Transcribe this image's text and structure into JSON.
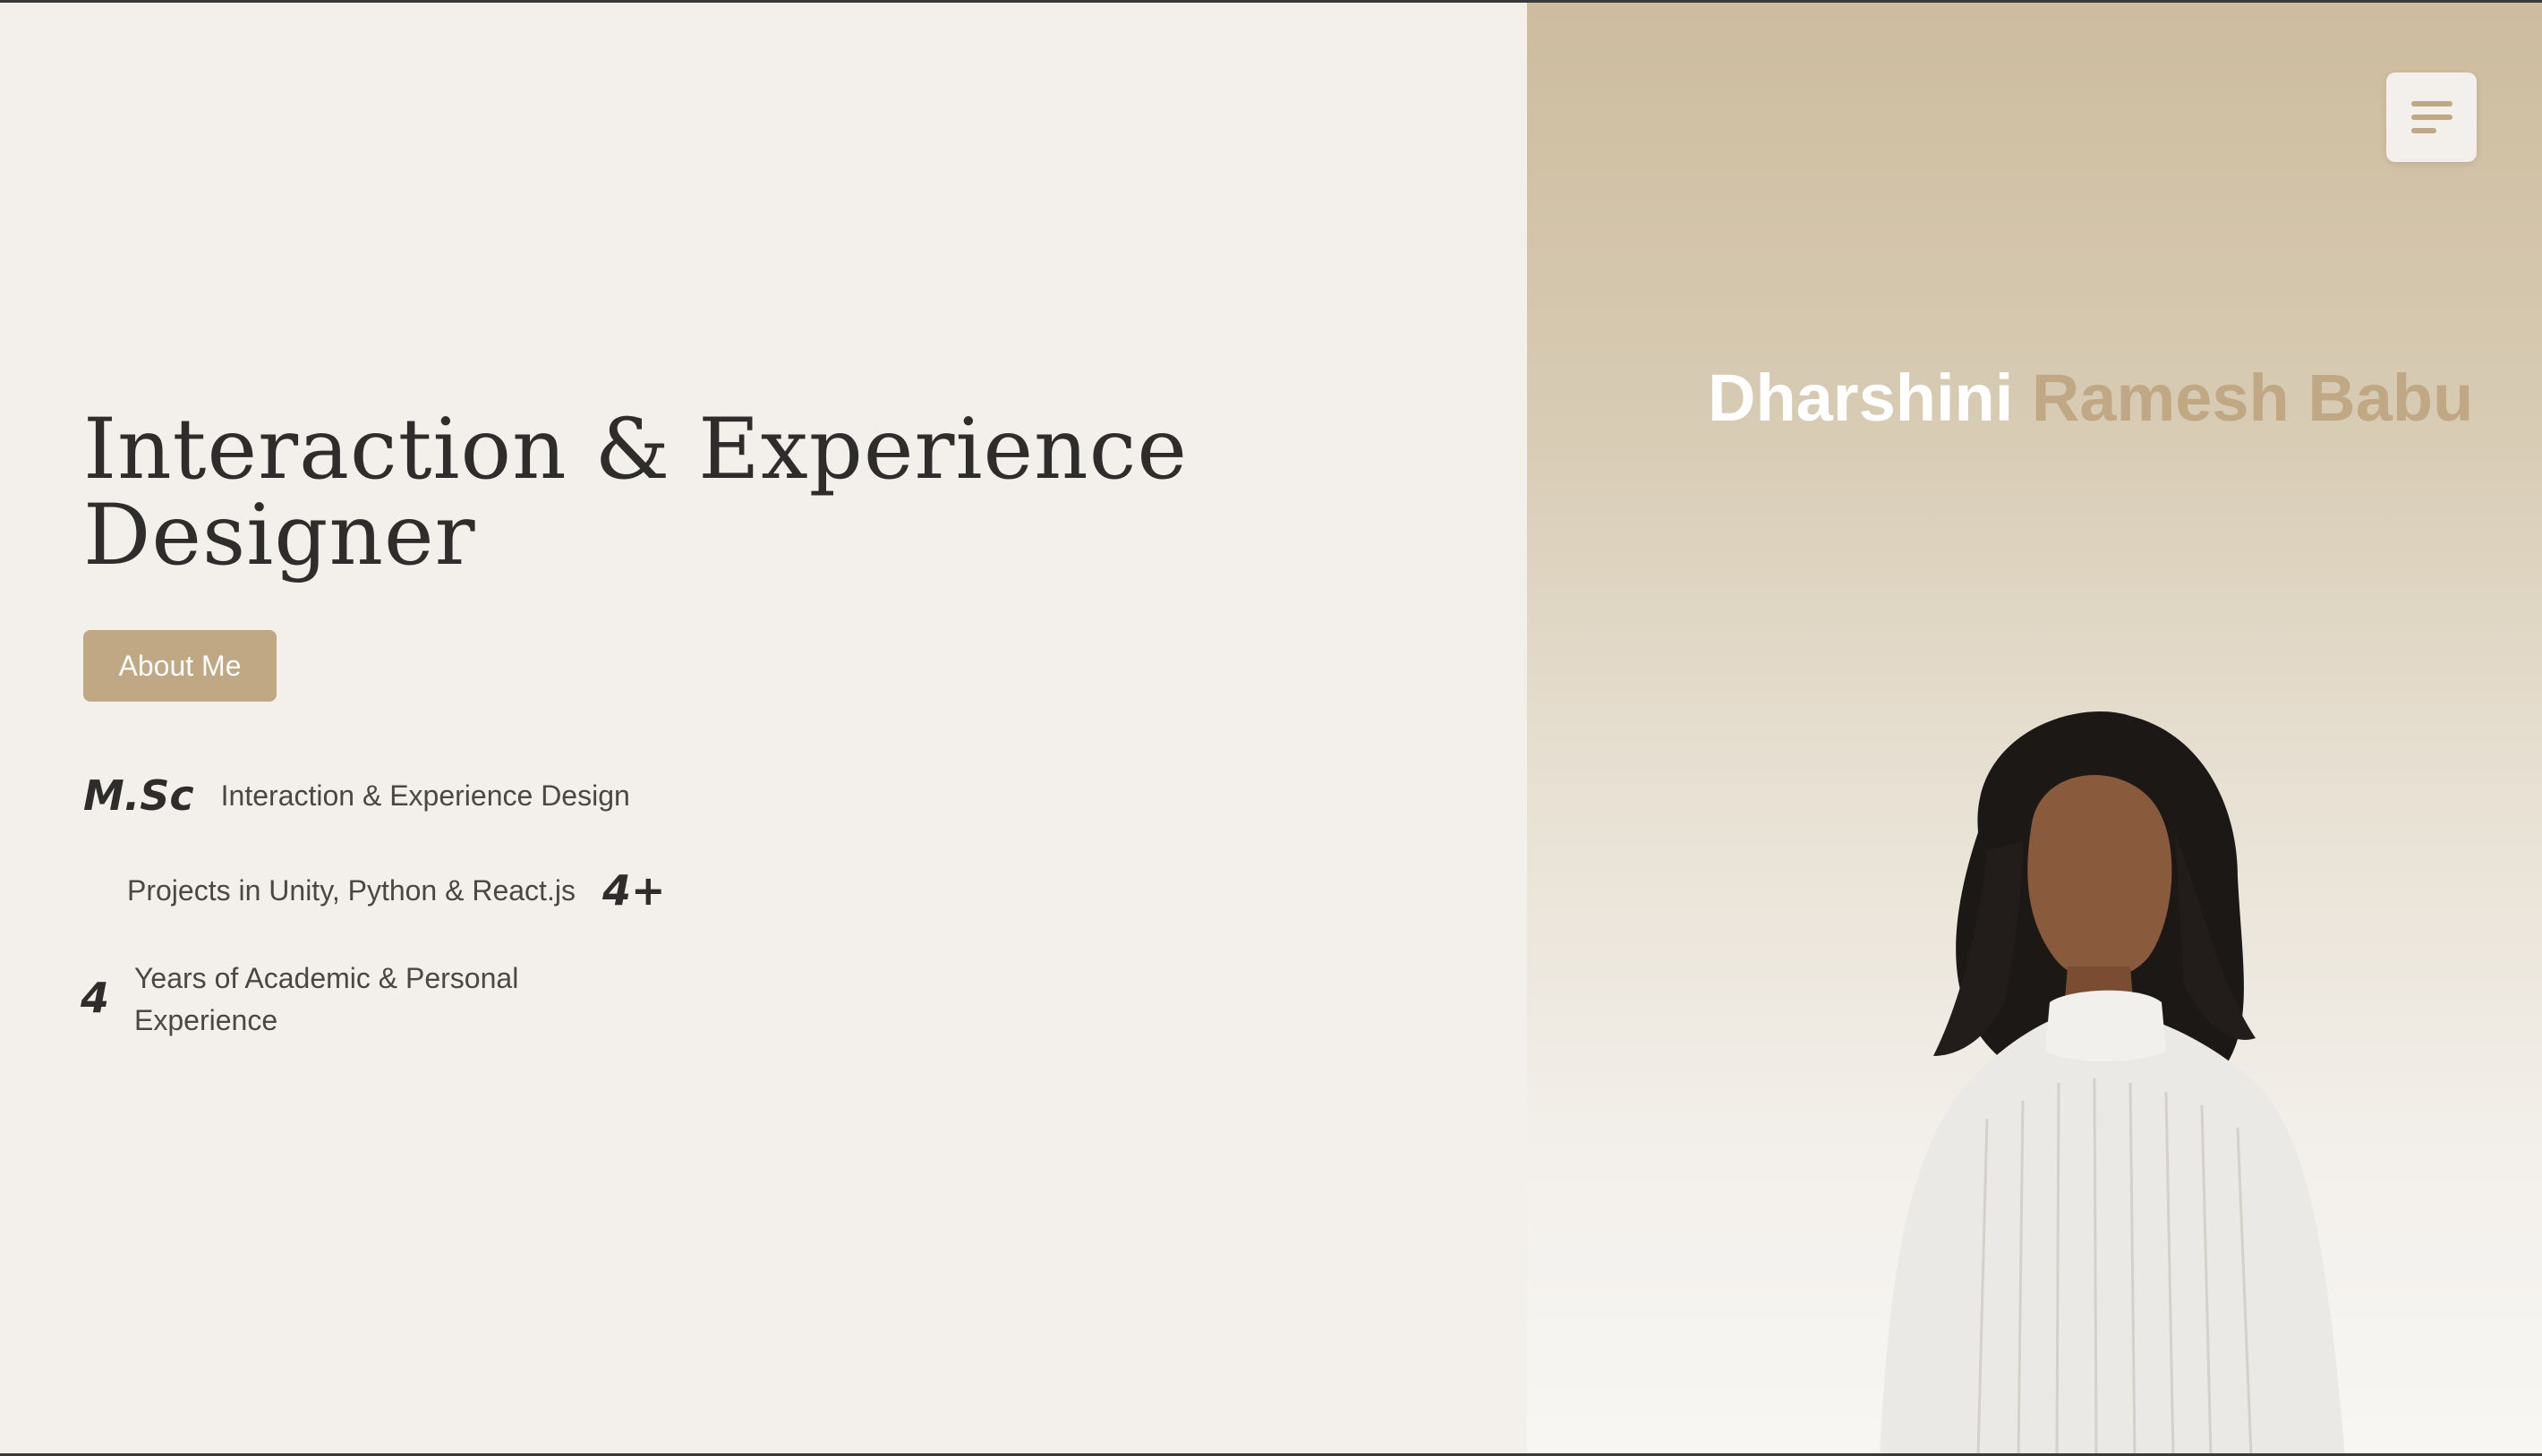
{
  "hero": {
    "title": "Interaction & Experience Designer",
    "about_button_label": "About Me"
  },
  "stats": [
    {
      "value": "M.Sc",
      "label": "Interaction & Experience Design"
    },
    {
      "value": "4+",
      "label": "Projects in Unity, Python & React.js"
    },
    {
      "value": "4",
      "label": "Years of Academic & Personal Experience"
    }
  ],
  "profile": {
    "first_name": "Dharshini",
    "last_name": "Ramesh Babu"
  },
  "icons": {
    "menu": "hamburger-menu-icon"
  },
  "colors": {
    "accent": "#bfa883",
    "background": "#f3f0eb",
    "text": "#2f2d2b"
  }
}
